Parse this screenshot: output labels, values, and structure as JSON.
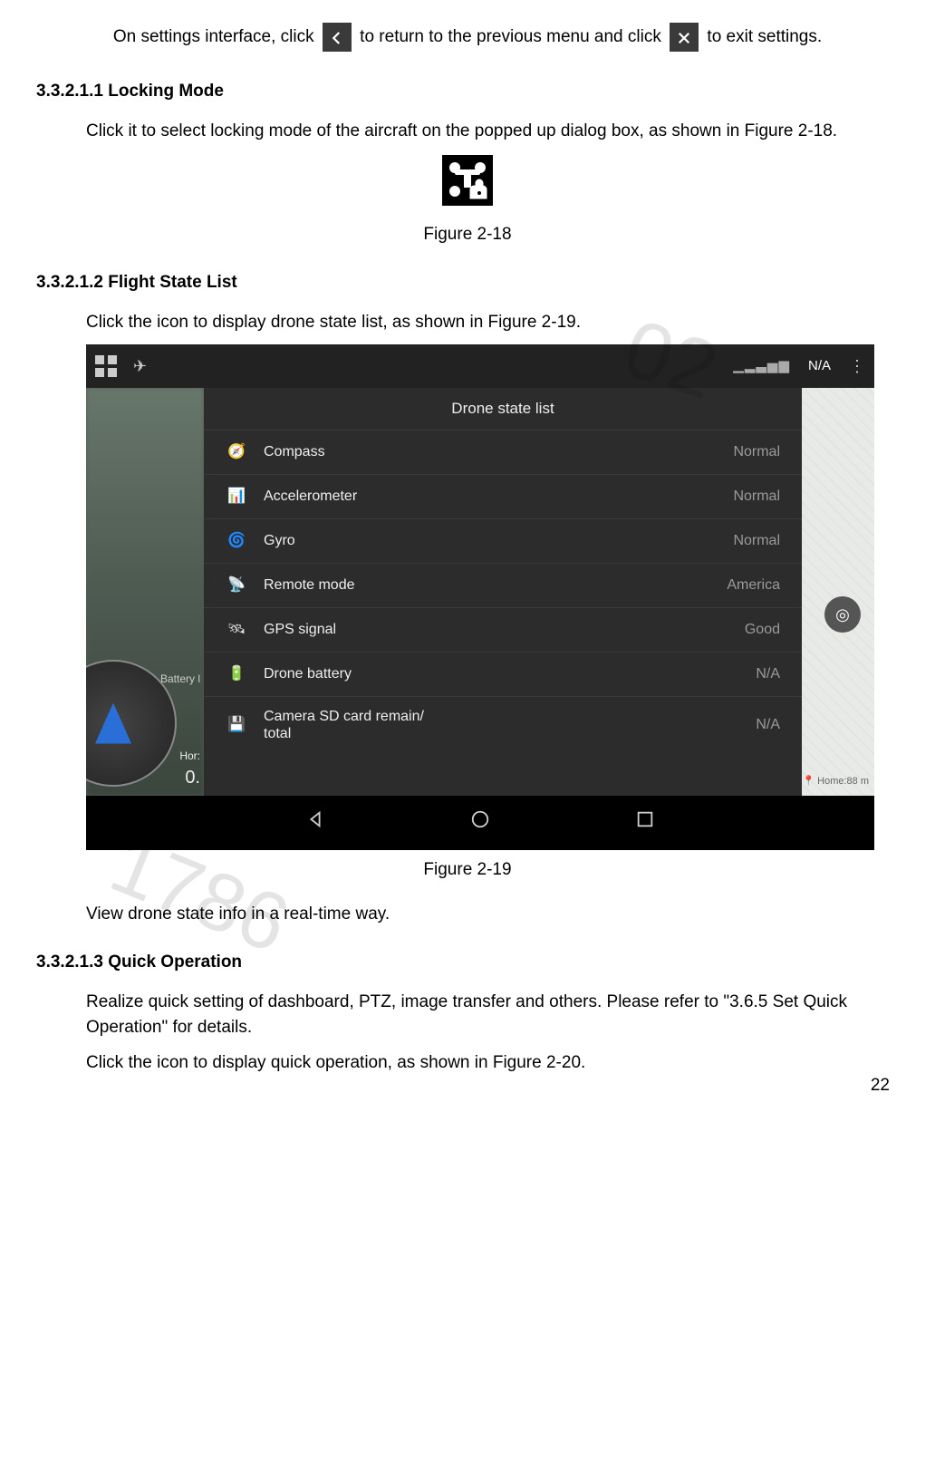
{
  "intro": {
    "t1": "On settings interface, click ",
    "t2": " to return to the previous menu and click ",
    "t3": " to exit settings."
  },
  "sec1": {
    "heading": "3.3.2.1.1 Locking Mode",
    "body": "Click it to select locking mode of the aircraft on the popped up dialog box, as shown in Figure 2-18.",
    "caption": "Figure 2-18"
  },
  "sec2": {
    "heading": "3.3.2.1.2 Flight State List",
    "body": "Click the icon to display drone state list, as shown in Figure 2-19.",
    "caption": "Figure 2-19",
    "after": "View drone state info in a real-time way."
  },
  "sec3": {
    "heading": "3.3.2.1.3 Quick Operation",
    "body1": "Realize quick setting of dashboard, PTZ, image transfer and others. Please refer to \"3.6.5 Set Quick Operation\" for details.",
    "body2": "Click the icon to display quick operation, as shown in Figure 2-20."
  },
  "shot": {
    "topbar": {
      "na": "N/A"
    },
    "panel_title": "Drone state list",
    "rows": [
      {
        "label": "Compass",
        "value": "Normal"
      },
      {
        "label": "Accelerometer",
        "value": "Normal"
      },
      {
        "label": "Gyro",
        "value": "Normal"
      },
      {
        "label": "Remote mode",
        "value": "America"
      },
      {
        "label": "GPS signal",
        "value": "Good"
      },
      {
        "label": "Drone battery",
        "value": "N/A"
      },
      {
        "label": "Camera SD card remain/\ntotal",
        "value": "N/A"
      }
    ],
    "left": {
      "battery": "Battery l",
      "hor1": "Hor:",
      "hor2": "0."
    },
    "right": {
      "home": "Home:88 m"
    }
  },
  "watermarks": {
    "w1": "02",
    "w2": "1786"
  },
  "page_number": "22"
}
